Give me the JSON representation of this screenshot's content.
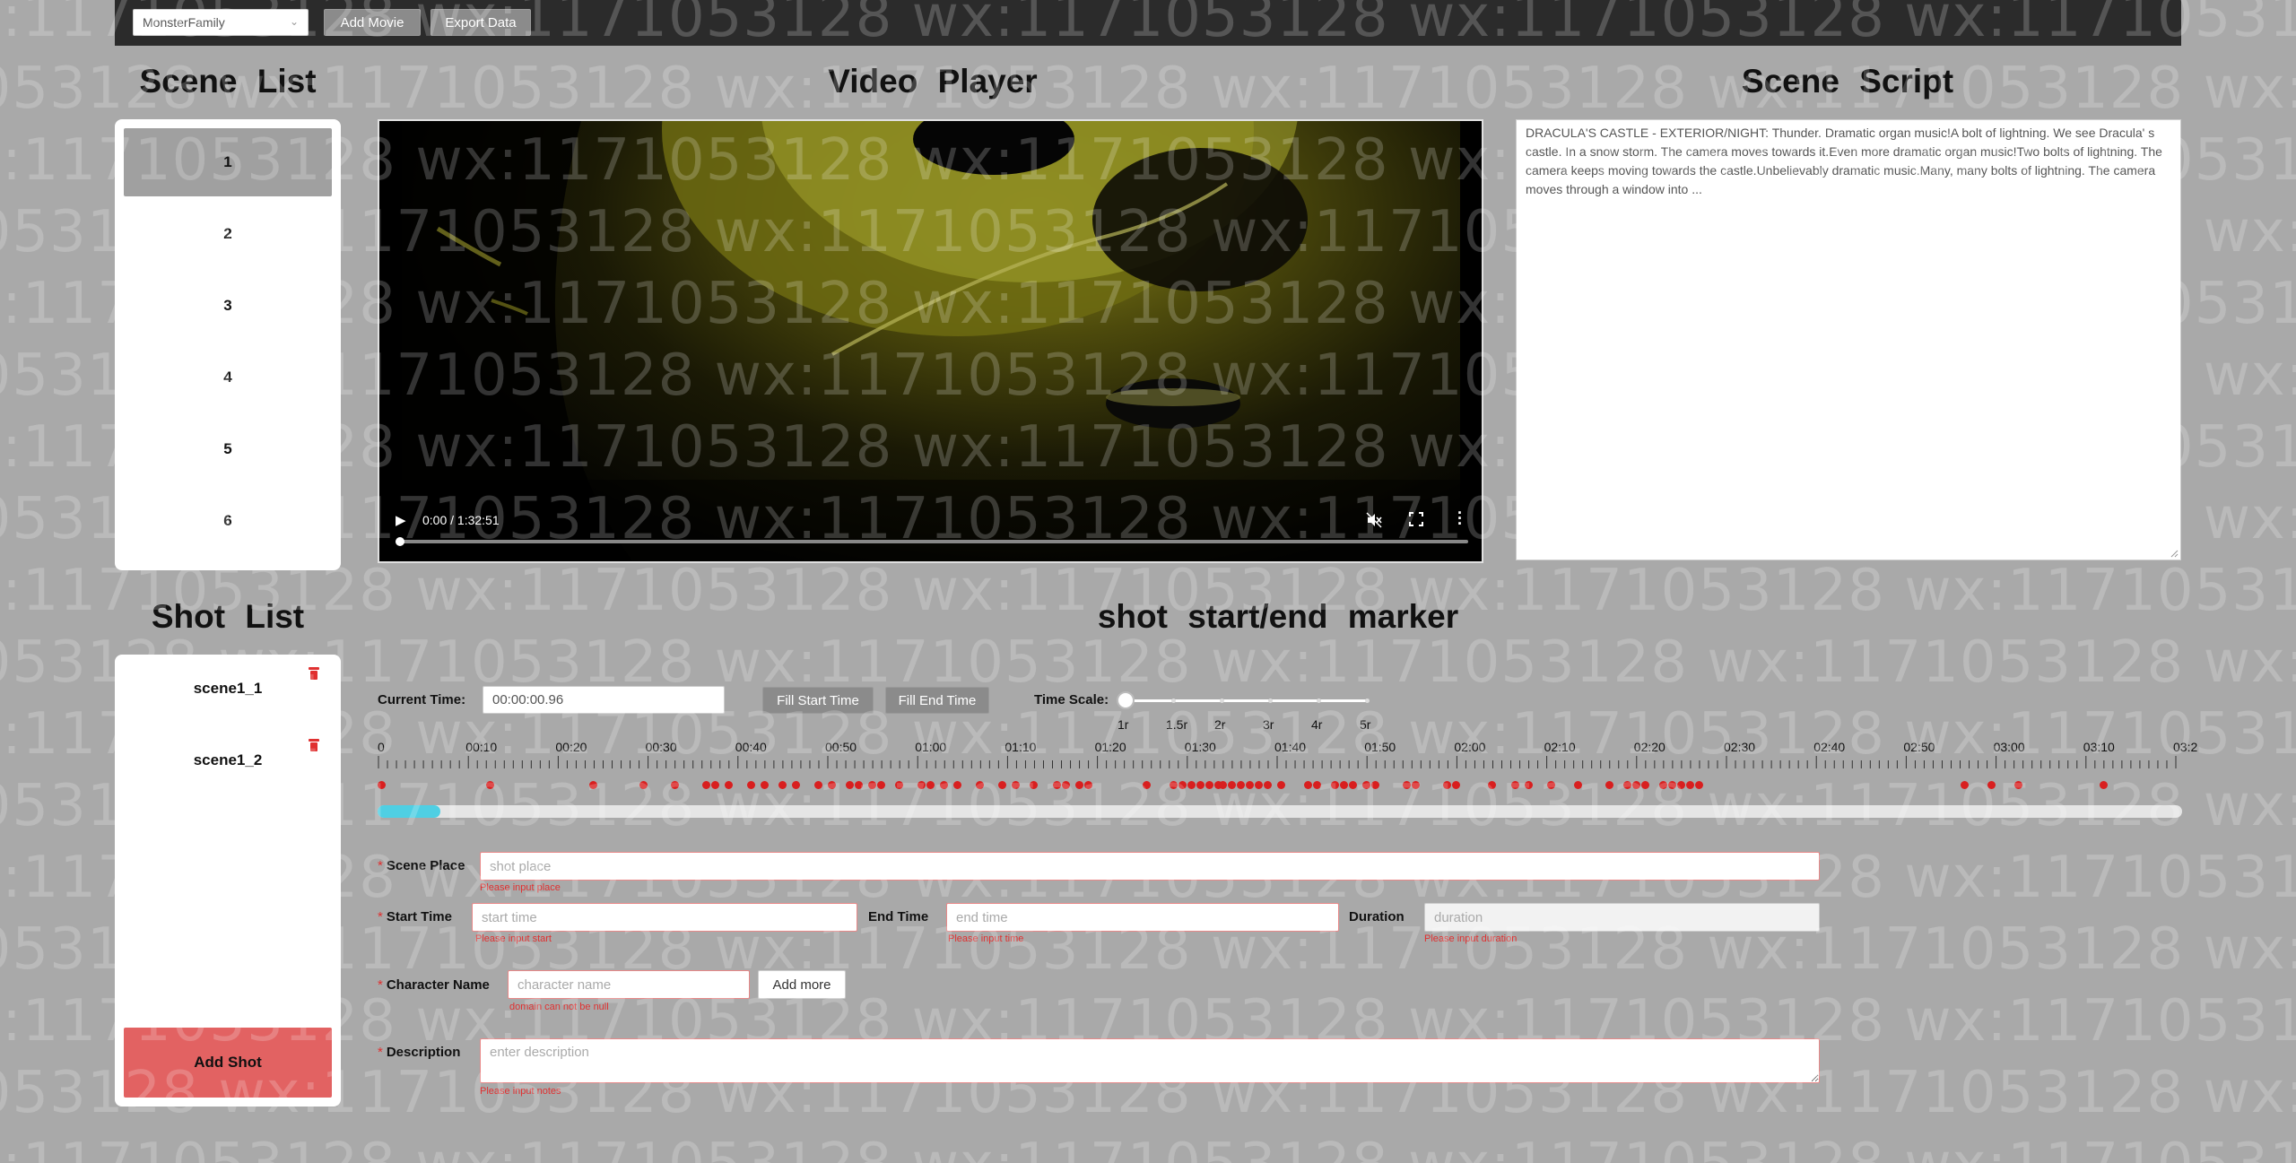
{
  "watermark": {
    "text": "wx:1171053128"
  },
  "toolbar": {
    "movie_select_value": "MonsterFamily",
    "add_movie_label": "Add Movie",
    "export_data_label": "Export Data"
  },
  "titles": {
    "scene_list": "Scene List",
    "video_player": "Video Player",
    "scene_script": "Scene Script",
    "shot_list": "Shot List",
    "marker": "shot start/end marker"
  },
  "scenes": [
    "1",
    "2",
    "3",
    "4",
    "5",
    "6"
  ],
  "active_scene": "1",
  "video": {
    "time_display": "0:00 / 1:32:51",
    "progress": 0
  },
  "script_text": "DRACULA'S CASTLE - EXTERIOR/NIGHT: Thunder. Dramatic organ music!A bolt of lightning. We see Dracula' s castle. In a snow storm. The camera moves towards it.Even more dramatic organ music!Two bolts of lightning. The camera keeps moving towards the castle.Unbelievably dramatic music.Many, many bolts of lightning. The camera moves through a window into ...",
  "shots": [
    "scene1_1",
    "scene1_2"
  ],
  "add_shot_label": "Add Shot",
  "marker": {
    "current_time_label": "Current Time:",
    "current_time_value": "00:00:00.96",
    "fill_start_label": "Fill Start Time",
    "fill_end_label": "Fill End Time",
    "time_scale_label": "Time Scale:",
    "scales": [
      "1r",
      "1.5r",
      "2r",
      "3r",
      "4r",
      "5r"
    ],
    "selected_scale": "1r",
    "ticks": [
      "0",
      "00:10",
      "00:20",
      "00:30",
      "00:40",
      "00:50",
      "01:00",
      "01:10",
      "01:20",
      "01:30",
      "01:40",
      "01:50",
      "02:00",
      "02:10",
      "02:20",
      "02:30",
      "02:40",
      "02:50",
      "03:00",
      "03:10",
      "03:2"
    ],
    "timeline_fill": 0.035,
    "markers_seconds": [
      0.4,
      12.5,
      24,
      29.5,
      33,
      36.5,
      37.5,
      39,
      41.5,
      43,
      45,
      46.5,
      49,
      50.5,
      52.5,
      53.5,
      55,
      56,
      58,
      60.5,
      61.5,
      63,
      64.5,
      67,
      69.5,
      71,
      73,
      75.5,
      76.5,
      78,
      79,
      85.5,
      88.5,
      89.5,
      90.5,
      91.5,
      92.5,
      93.5,
      94,
      95,
      96,
      97,
      98,
      99,
      100.5,
      103.5,
      104.5,
      106.5,
      107.5,
      108.5,
      110,
      111,
      114.5,
      115.5,
      119,
      120,
      124,
      126.5,
      128,
      130.5,
      133.5,
      137,
      139,
      140,
      141,
      143,
      144,
      145,
      146,
      147,
      176.5,
      179.5,
      182.5,
      192
    ]
  },
  "form": {
    "scene_place_label": "Scene Place",
    "scene_place_placeholder": "shot place",
    "scene_place_error": "Please input place",
    "start_time_label": "Start Time",
    "start_time_placeholder": "start time",
    "start_time_error": "Please input start",
    "end_time_label": "End Time",
    "end_time_placeholder": "end time",
    "end_time_error": "Please input time",
    "duration_label": "Duration",
    "duration_placeholder": "duration",
    "duration_error": "Please input duration",
    "character_label": "Character Name",
    "character_placeholder": "character name",
    "character_error": "domain can not be null",
    "add_more_label": "Add more",
    "description_label": "Description",
    "description_placeholder": "enter description",
    "description_error": "Please input notes"
  },
  "colors": {
    "background": "#a9a9a9",
    "topbar": "#2b2b2b",
    "button_gray": "#8b8b8b",
    "add_shot_red": "#e26262",
    "marker_red": "#d81f1f",
    "timeline_fill": "#4fcfe3",
    "error_red": "#e03030"
  }
}
